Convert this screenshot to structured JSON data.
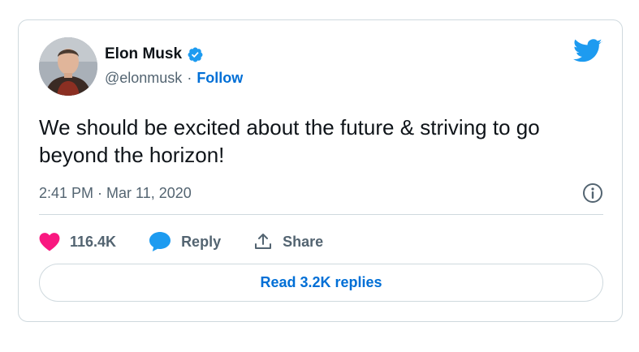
{
  "author": {
    "name": "Elon Musk",
    "handle": "@elonmusk",
    "separator": "·",
    "follow_label": "Follow",
    "verified": true
  },
  "tweet": {
    "text": "We should be excited about the future & striving to go beyond the horizon!",
    "timestamp": "2:41 PM · Mar 11, 2020"
  },
  "actions": {
    "likes_count": "116.4K",
    "reply_label": "Reply",
    "share_label": "Share"
  },
  "read_replies_label": "Read 3.2K replies",
  "colors": {
    "twitter_blue": "#1d9bf0",
    "link_blue": "#006fd6",
    "like_pink": "#f91880",
    "text_primary": "#0f1419",
    "text_secondary": "#536471",
    "border": "#cfd9de"
  },
  "icons": [
    "verified-badge-icon",
    "twitter-bird-icon",
    "info-icon",
    "heart-icon",
    "reply-bubble-icon",
    "share-icon"
  ]
}
